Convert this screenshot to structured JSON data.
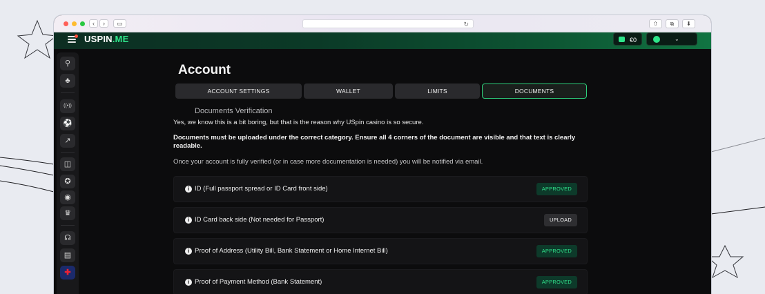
{
  "app": {
    "logo_prefix": "USPIN",
    "logo_suffix": ".ME",
    "balance": "€0"
  },
  "chrome": {
    "back_icon": "chevron-left-icon",
    "forward_icon": "chevron-right-icon"
  },
  "sidebar": {
    "items": [
      {
        "icon": "search-icon",
        "glyph": "⌕"
      },
      {
        "icon": "casino-club-icon",
        "glyph": "♣"
      },
      {
        "icon": "live-broadcast-icon",
        "glyph": "((•))"
      },
      {
        "icon": "sports-ball-icon",
        "glyph": "⚽"
      },
      {
        "icon": "chart-icon",
        "glyph": "↗"
      },
      {
        "icon": "gift-icon",
        "glyph": "🎁"
      },
      {
        "icon": "badge-icon",
        "glyph": "✪"
      },
      {
        "icon": "money-bag-icon",
        "glyph": "💰"
      },
      {
        "icon": "crown-icon",
        "glyph": "♛"
      },
      {
        "icon": "headset-icon",
        "glyph": "🎧"
      },
      {
        "icon": "cashier-icon",
        "glyph": "▤"
      },
      {
        "icon": "uk-flag-icon",
        "glyph": "✚"
      }
    ]
  },
  "page": {
    "title": "Account",
    "tabs": [
      {
        "label": "ACCOUNT SETTINGS",
        "active": false
      },
      {
        "label": "WALLET",
        "active": false
      },
      {
        "label": "LIMITS",
        "active": false
      },
      {
        "label": "DOCUMENTS",
        "active": true
      }
    ],
    "section_heading": "Documents Verification",
    "intro": "Yes, we know this is a bit boring, but that is the reason why USpin casino is so secure.",
    "instructions": "Documents must be uploaded under the correct category. Ensure all 4 corners of the document are visible and that text is clearly readable.",
    "notice": "Once your account is fully verified (or in case more documentation is needed) you will be notified via email.",
    "documents": [
      {
        "label": "ID (Full passport spread or ID Card front side)",
        "status": "APPROVED"
      },
      {
        "label": "ID Card back side (Not needed for Passport)",
        "status": "UPLOAD"
      },
      {
        "label": "Proof of Address (Utility Bill, Bank Statement or Home Internet Bill)",
        "status": "APPROVED"
      },
      {
        "label": "Proof of Payment Method (Bank Statement)",
        "status": "APPROVED"
      }
    ]
  },
  "colors": {
    "accent": "#2ee58a",
    "approved_bg": "#0d3a2a",
    "background": "#0c0c0d"
  }
}
